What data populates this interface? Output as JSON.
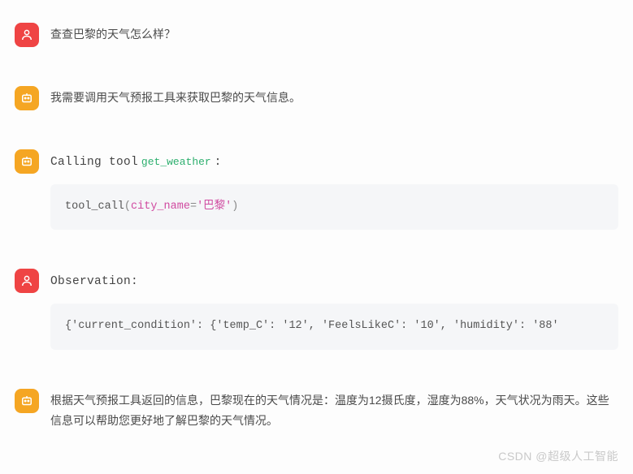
{
  "messages": {
    "user_question": "查查巴黎的天气怎么样？",
    "assistant_plan": "我需要调用天气预报工具来获取巴黎的天气信息。",
    "calling_tool_prefix": "Calling tool",
    "tool_name": "get_weather",
    "calling_tool_suffix": " :",
    "tool_call_code": {
      "func": "tool_call",
      "open_paren": "(",
      "kwarg": "city_name",
      "eq": "=",
      "value": "'巴黎'",
      "close_paren": ")"
    },
    "observation_label": "Observation:",
    "observation_content": "{'current_condition': {'temp_C': '12', 'FeelsLikeC': '10', 'humidity': '88'",
    "assistant_summary": "根据天气预报工具返回的信息，巴黎现在的天气情况是：温度为12摄氏度，湿度为88%，天气状况为雨天。这些信息可以帮助您更好地了解巴黎的天气情况。"
  },
  "watermark": "CSDN @超级人工智能"
}
